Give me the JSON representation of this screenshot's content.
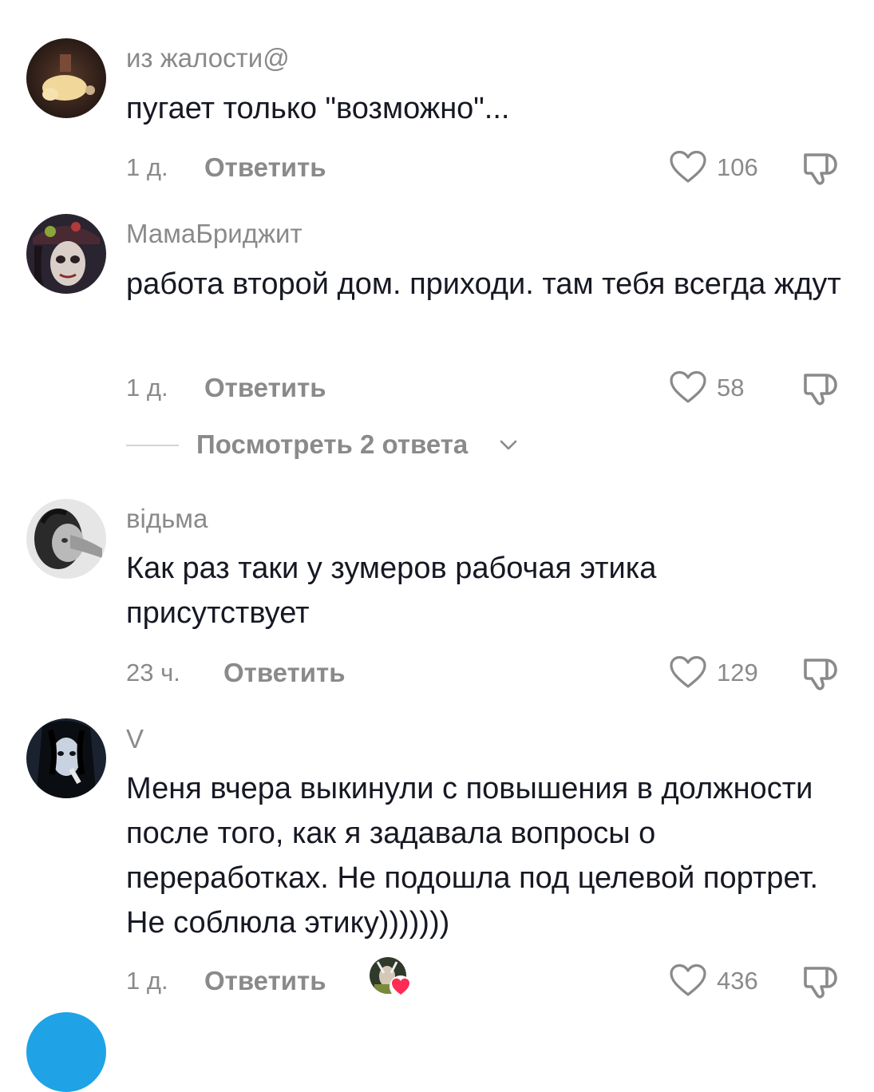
{
  "comments": [
    {
      "username": "из жалости@",
      "text": "пугает только \"возможно\"...",
      "time": "1 д.",
      "reply_label": "Ответить",
      "likes": "106"
    },
    {
      "username": "МамаБриджит",
      "text": "работа второй дом. приходи. там тебя всегда ждут",
      "time": "1 д.",
      "reply_label": "Ответить",
      "likes": "58",
      "view_replies": "Посмотреть 2 ответа"
    },
    {
      "username": "відьма",
      "text": "Как раз таки у зумеров рабочая этика присутствует",
      "time": "23 ч.",
      "reply_label": "Ответить",
      "likes": "129"
    },
    {
      "username": "V",
      "text": "Меня вчера выкинули с повышения в должности после того, как я задавала вопросы о переработках. Не подошла под целевой портрет. Не соблюла этику)))))))",
      "time": "1 д.",
      "reply_label": "Ответить",
      "likes": "436"
    }
  ],
  "icons": {
    "like": "heart-outline-icon",
    "dislike": "thumbs-down-icon",
    "expand": "chevron-down-icon",
    "creator_liked": "creator-heart-icon"
  },
  "colors": {
    "text": "#161823",
    "secondary": "#8a8a8a",
    "creator_heart": "#fe2c55"
  }
}
